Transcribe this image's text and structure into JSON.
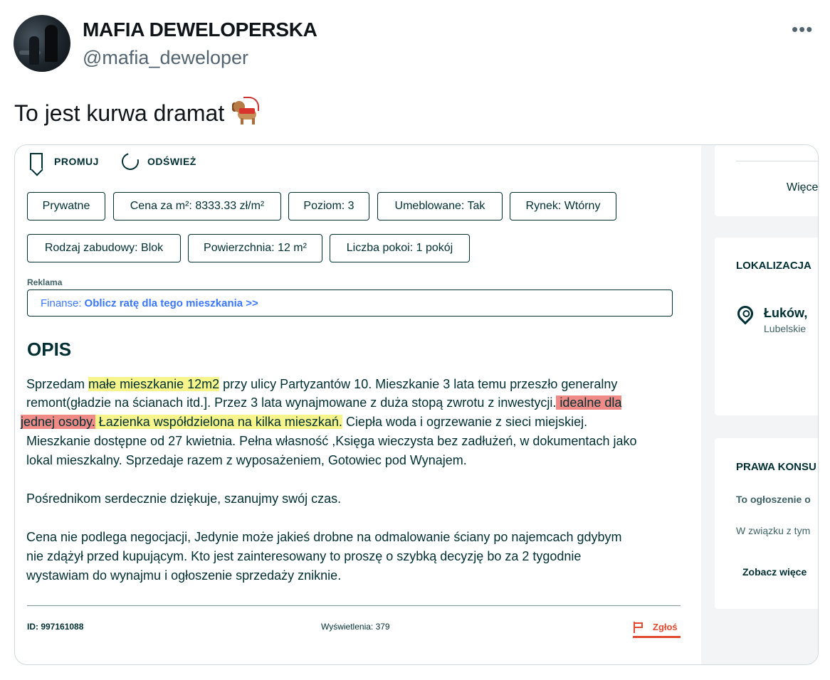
{
  "tweet": {
    "display_name": "MAFIA DEWELOPERSKA",
    "handle": "@mafia_deweloper",
    "more": "•••",
    "text": "To jest kurwa dramat"
  },
  "listing": {
    "toolbar": {
      "promote": "PROMUJ",
      "refresh": "ODŚWIEŻ"
    },
    "tags_row1": [
      "Prywatne",
      "Cena za m²: 8333.33 zł/m²",
      "Poziom: 3",
      "Umeblowane: Tak",
      "Rynek: Wtórny"
    ],
    "tags_row2": [
      "Rodzaj zabudowy: Blok",
      "Powierzchnia: 12 m²",
      "Liczba pokoi: 1 pokój"
    ],
    "ad_label": "Reklama",
    "finance_prefix": "Finanse:",
    "finance_link": "Oblicz ratę dla tego mieszkania >>",
    "section_title": "OPIS",
    "desc": {
      "l1_a": "Sprzedam ",
      "l1_hl": "małe mieszkanie 12m2",
      "l1_b": " przy ulicy Partyzantów 10. Mieszkanie 3 lata temu przeszło generalny",
      "l2_a": "remont(gładzie na ścianach itd.]. Przez 3 lata wynajmowane z duża stopą zwrotu z inwestycji.",
      "l2_hl": " idealne dla",
      "l3_hl_r": "jednej osoby.",
      "l3_hl_y": " Łazienka współdzielona na kilka mieszkań.",
      "l3_b": " Ciepła woda i ogrzewanie z sieci miejskiej.",
      "l4": "Mieszkanie dostępne od 27 kwietnia. Pełna własność ,Księga wieczysta bez zadłużeń, w dokumentach jako",
      "l5": "lokal mieszkalny. Sprzedaje razem z wyposażeniem, Gotowiec pod Wynajem.",
      "p2": "Pośrednikom serdecznie dziękuje, szanujmy swój czas.",
      "p3_l1": "Cena nie podlega negocjacji, Jedynie może jakieś drobne na odmalowanie ściany po najemcach gdybym",
      "p3_l2": "nie zdążył przed kupującym. Kto jest zainteresowany to proszę o szybką decyzję bo za 2 tygodnie",
      "p3_l3": "wystawiam do wynajmu i ogłoszenie sprzedaży zniknie."
    },
    "footer": {
      "id": "ID: 997161088",
      "views": "Wyświetlenia: 379",
      "report": "Zgłoś"
    }
  },
  "sidebar": {
    "more_link": "Więce",
    "location_title": "LOKALIZACJA",
    "city": "Łuków,",
    "region": "Lubelskie",
    "consumer_title": "PRAWA KONSU",
    "consumer_bold": "To ogłoszenie o",
    "consumer_text": "W związku z tym",
    "see_more": "Zobacz więce"
  },
  "colors": {
    "brand_dark": "#002f34",
    "highlight_yellow": "#f6f48a",
    "highlight_red": "#f08a86",
    "report_red": "#e14a2e",
    "link_blue": "#3a77ff"
  }
}
